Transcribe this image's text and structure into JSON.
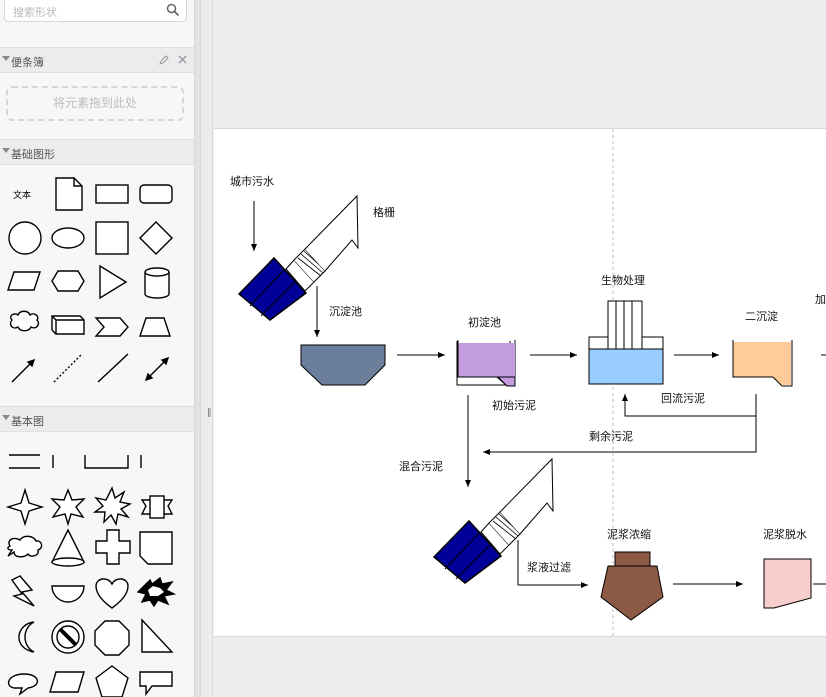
{
  "sidebar": {
    "search_placeholder": "搜索形状",
    "sections": {
      "scratchpad": "便条簿",
      "general": "基础图形",
      "basic": "基本图"
    },
    "dropzone_text": "将元素拖到此处",
    "text_shape_label": "文本"
  },
  "diagram": {
    "labels": {
      "city_sewage": "城市污水",
      "grille": "格栅",
      "settling_tank": "沉淀池",
      "primary_tank": "初淀池",
      "bio_treatment": "生物处理",
      "secondary_settling": "二沉淀",
      "add_partial": "加",
      "initial_sludge": "初始污泥",
      "return_sludge": "回流污泥",
      "excess_sludge": "剩余污泥",
      "mixed_sludge": "混合污泥",
      "slurry_filter": "浆液过滤",
      "sludge_thicken": "泥浆浓缩",
      "sludge_dewater": "泥浆脱水"
    },
    "colors": {
      "screen_blue": "#000099",
      "settling_gray": "#6b7f9c",
      "primary_purple": "#c39bdf",
      "bio_blue": "#99ccff",
      "secondary_orange": "#ffcc99",
      "thicken_brown": "#8c5a44",
      "dewater_pink": "#f8cecc"
    }
  }
}
